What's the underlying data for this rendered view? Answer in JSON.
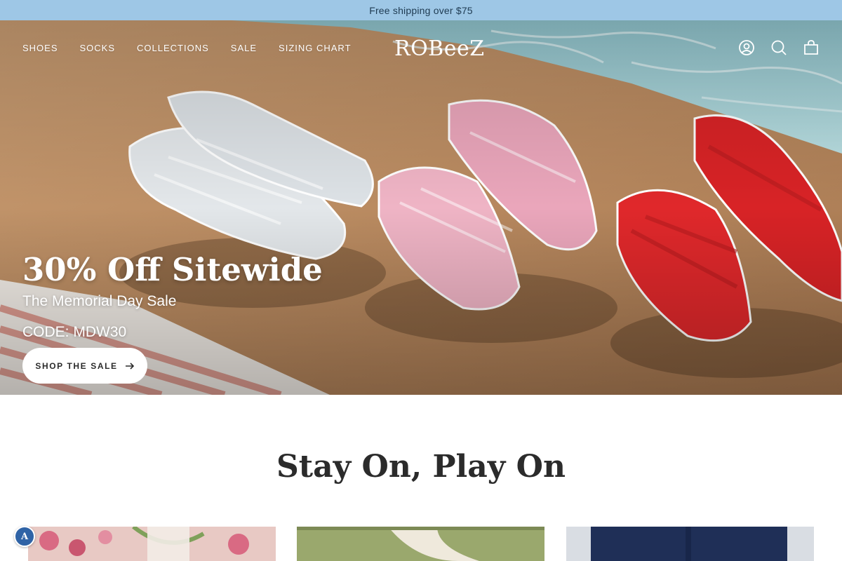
{
  "announcement": {
    "text": "Free shipping over $75"
  },
  "nav": {
    "links": [
      "SHOES",
      "SOCKS",
      "COLLECTIONS",
      "SALE",
      "SIZING CHART"
    ],
    "logo_text": "ROBeeZ",
    "icons": [
      "account-icon",
      "search-icon",
      "cart-icon"
    ]
  },
  "hero": {
    "title": "30% Off Sitewide",
    "subtitle": "The Memorial Day Sale",
    "code": "CODE: MDW30",
    "button_label": "SHOP THE SALE",
    "sandal_colors": [
      "#e9ecef",
      "#f0b7c8",
      "#e0282b"
    ]
  },
  "section": {
    "title": "Stay On, Play On"
  },
  "accessibility": {
    "label": "A"
  },
  "colors": {
    "announcement_bg": "#9ec7e6",
    "button_bg": "#ffffff",
    "text_dark": "#2b2b2b"
  }
}
